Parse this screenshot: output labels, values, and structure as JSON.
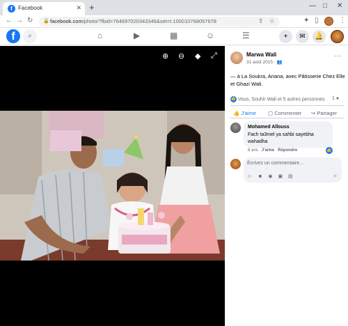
{
  "browser": {
    "tab_title": "Facebook",
    "tab_favicon": "f",
    "tab_close": "✕",
    "new_tab": "+",
    "window_controls": [
      "—",
      "□",
      "✕"
    ],
    "nav": [
      "←",
      "→",
      "↻"
    ],
    "url_domain": "facebook.com",
    "url_rest": "/photo/?fbid=764697020343346&set=t.100010768057678",
    "omnibox_icons": [
      "⇪",
      "☆"
    ],
    "toolbar_icons": [
      "✦",
      "▯",
      "⋮"
    ]
  },
  "fb": {
    "logo": "f",
    "search_icon": "⌕",
    "nav_icons": [
      "⌂",
      "▶",
      "▦",
      "☺",
      "☰"
    ],
    "right_icons": [
      "+",
      "✉",
      "🔔"
    ]
  },
  "viewer": {
    "controls": [
      "⊕",
      "⊖",
      "◆",
      "⤢"
    ]
  },
  "post": {
    "author": "Marwa Wali",
    "date": "31 août 2015 · 👥",
    "more": "···",
    "text": "— à La Soukra, Ariana, avec Pâtisserie Chez Elle et Ghazi Wali.",
    "reactions_icon": "👍",
    "reactions_text": "Vous, Souhir Wali et 5 autres personnes",
    "comment_count": "1 ●",
    "actions": [
      {
        "icon": "👍",
        "label": "J'aime"
      },
      {
        "icon": "▢",
        "label": "Commenter"
      },
      {
        "icon": "↪",
        "label": "Partager"
      }
    ]
  },
  "comment": {
    "author": "Mohamed Allouss",
    "text": "Fach ta3mel ya sahbi sayebha wahadha",
    "age": "8 ans",
    "like": "J'aime",
    "reply": "Répondre",
    "like_badge": "👍"
  },
  "composer": {
    "placeholder": "Écrivez un commentaire…",
    "icons": "☺ ☻ ◉ ▣ ▤",
    "send": "➤"
  },
  "colors": {
    "fb_blue": "#1877f2",
    "bubble": "#f0f2f5"
  }
}
